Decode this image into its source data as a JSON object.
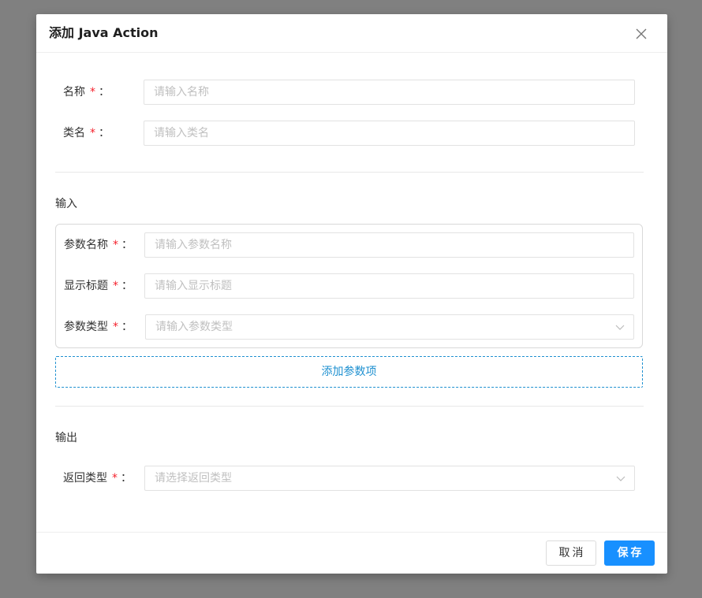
{
  "dialog": {
    "title": "添加 Java Action",
    "close_label": "×"
  },
  "fields": {
    "name": {
      "label": "名称",
      "required": "*",
      "colon": "：",
      "placeholder": "请输入名称",
      "value": ""
    },
    "class_name": {
      "label": "类名",
      "required": "*",
      "colon": "：",
      "placeholder": "请输入类名",
      "value": ""
    }
  },
  "input_section": {
    "title": "输入",
    "param_name": {
      "label": "参数名称",
      "required": "*",
      "colon": "：",
      "placeholder": "请输入参数名称",
      "value": ""
    },
    "display_title": {
      "label": "显示标题",
      "required": "*",
      "colon": "：",
      "placeholder": "请输入显示标题",
      "value": ""
    },
    "param_type": {
      "label": "参数类型",
      "required": "*",
      "colon": "：",
      "placeholder": "请输入参数类型"
    },
    "add_param_label": "添加参数项"
  },
  "output_section": {
    "title": "输出",
    "return_type": {
      "label": "返回类型",
      "required": "*",
      "colon": "：",
      "placeholder": "请选择返回类型"
    }
  },
  "footer": {
    "cancel_label": "取消",
    "save_label": "保存"
  },
  "colors": {
    "accent": "#1890ff",
    "link": "#1e90d0",
    "required": "#f5222d",
    "overlay": "#808080"
  }
}
